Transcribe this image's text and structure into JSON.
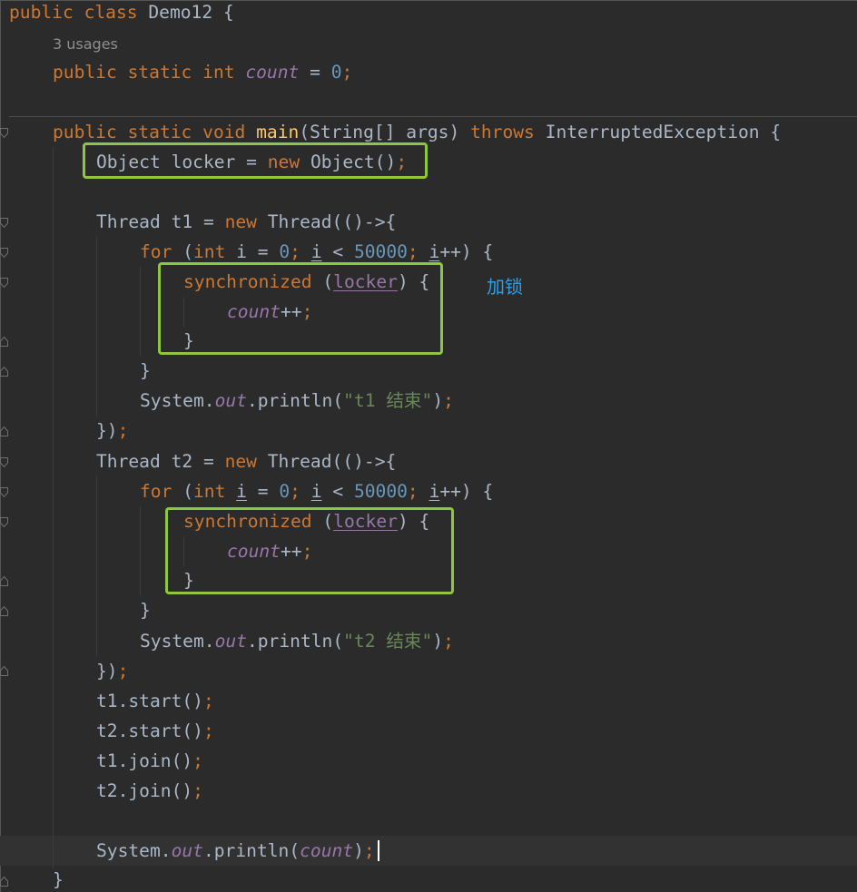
{
  "editor": {
    "l1": {
      "a": "public class ",
      "b": "Demo12 {"
    },
    "usages": "3 usages",
    "l3": {
      "a": "public static int ",
      "b": "count",
      "c": " = ",
      "d": "0",
      "e": ";"
    },
    "l4": {
      "a": "public static void ",
      "b": "main",
      "c": "(String[] args) ",
      "d": "throws ",
      "e": "InterruptedException {"
    },
    "l5": {
      "a": "Object locker = ",
      "b": "new ",
      "c": "Object()",
      "d": ";"
    },
    "l7": {
      "a": "Thread t1 = ",
      "b": "new ",
      "c": "Thread(()->{"
    },
    "l8": {
      "a": "for ",
      "b": "(",
      "c": "int ",
      "d": "i = ",
      "e": "0",
      "f": "; ",
      "g": "i",
      "h": " < ",
      "i": "50000",
      "j": "; ",
      "k": "i",
      "l": "++) {"
    },
    "l9": {
      "a": "synchronized ",
      "b": "(",
      "c": "locker",
      "d": ") {"
    },
    "l10": {
      "a": "count",
      "b": "++",
      "c": ";"
    },
    "l11": "}",
    "l12": "}",
    "l13": {
      "a": "System.",
      "b": "out",
      "c": ".println(",
      "d": "\"t1 结束\"",
      "e": ")",
      "f": ";"
    },
    "l14": {
      "a": "})",
      "b": ";"
    },
    "l15": {
      "a": "Thread t2 = ",
      "b": "new ",
      "c": "Thread(()->{"
    },
    "l16": {
      "a": "for ",
      "b": "(",
      "c": "int ",
      "d": "i",
      "e": " = ",
      "f": "0",
      "g": "; ",
      "h": "i",
      "i": " < ",
      "j": "50000",
      "k": "; ",
      "l": "i",
      "m": "++) {"
    },
    "l17": {
      "a": "synchronized ",
      "b": "(",
      "c": "locker",
      "d": ") {"
    },
    "l18": {
      "a": "count",
      "b": "++",
      "c": ";"
    },
    "l19": "}",
    "l20": "}",
    "l21": {
      "a": "System.",
      "b": "out",
      "c": ".println(",
      "d": "\"t2 结束\"",
      "e": ")",
      "f": ";"
    },
    "l22": {
      "a": "})",
      "b": ";"
    },
    "l23": {
      "a": "t1.start()",
      "b": ";"
    },
    "l24": {
      "a": "t2.start()",
      "b": ";"
    },
    "l25": {
      "a": "t1.join()",
      "b": ";"
    },
    "l26": {
      "a": "t2.join()",
      "b": ";"
    },
    "l28": {
      "a": "System.",
      "b": "out",
      "c": ".println(",
      "d": "count",
      "e": ")",
      "f": ";"
    },
    "l29": "}"
  },
  "annotation": "加锁",
  "colors": {
    "background": "#2b2b2b",
    "keyword": "#cc7832",
    "number": "#6897bb",
    "static_field": "#9876aa",
    "string": "#6a8759",
    "method_decl": "#ffc66d",
    "text": "#a9b7c6",
    "highlight_box": "#8dc63f",
    "annotation": "#2c9fea"
  }
}
